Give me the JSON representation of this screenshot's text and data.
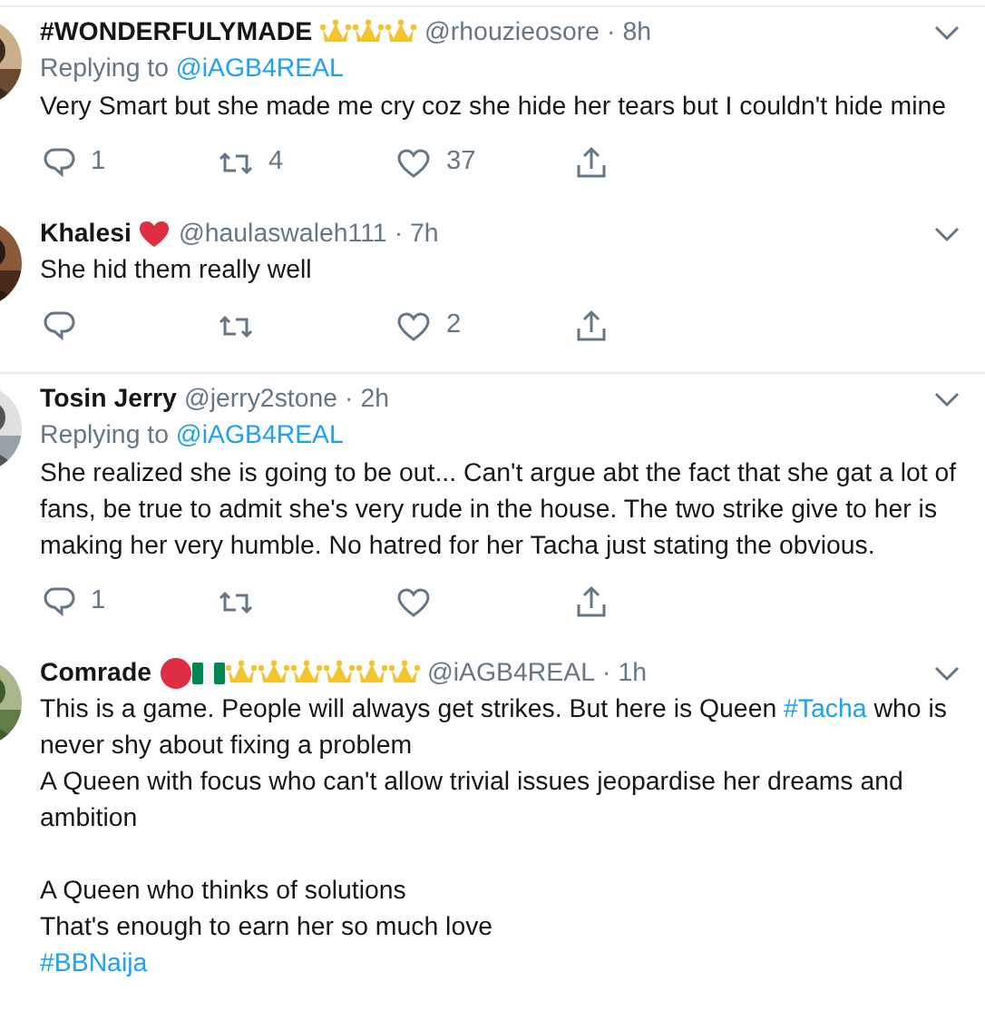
{
  "tweets": [
    {
      "name": "#WONDERFULYMADE",
      "badges": [
        {
          "kind": "crown"
        },
        {
          "kind": "crown"
        },
        {
          "kind": "crown"
        }
      ],
      "handle": "@rhouzieosore",
      "separator": "·",
      "time": "8h",
      "replying_label": "Replying to",
      "replying_to": "@iAGB4REAL",
      "paragraphs": [
        [
          [
            {
              "kind": "plain",
              "text": "Very Smart but she made me cry coz she hide her tears but I couldn't hide mine"
            }
          ]
        ]
      ],
      "replies": "1",
      "retweets": "4",
      "likes": "37",
      "divider": false
    },
    {
      "name": "Khalesi",
      "badges": [
        {
          "kind": "heart"
        }
      ],
      "handle": "@haulaswaleh111",
      "separator": "·",
      "time": "7h",
      "paragraphs": [
        [
          [
            {
              "kind": "plain",
              "text": "She hid them really well"
            }
          ]
        ]
      ],
      "likes": "2",
      "divider": false
    },
    {
      "name": "Tosin Jerry",
      "handle": "@jerry2stone",
      "separator": "·",
      "time": "2h",
      "replying_label": "Replying to",
      "replying_to": "@iAGB4REAL",
      "paragraphs": [
        [
          [
            {
              "kind": "plain",
              "text": "She realized she is going to be out... Can't argue abt the fact that she gat a lot of fans, be true to admit she's very rude in the house. The two strike give to her is making her very humble. No hatred for her Tacha just stating the obvious."
            }
          ]
        ]
      ],
      "replies": "1",
      "divider": true
    },
    {
      "name": "Comrade",
      "badges": [
        {
          "kind": "red-circle"
        },
        {
          "kind": "flag"
        },
        {
          "kind": "crown"
        },
        {
          "kind": "crown"
        },
        {
          "kind": "crown"
        },
        {
          "kind": "crown"
        },
        {
          "kind": "crown"
        },
        {
          "kind": "crown"
        }
      ],
      "handle": "@iAGB4REAL",
      "separator": "·",
      "time": "1h",
      "paragraphs": [
        [
          [
            {
              "kind": "plain",
              "text": "This is a game. People will always get strikes. But here is Queen "
            },
            {
              "kind": "hashtag",
              "text": "#Tacha"
            },
            {
              "kind": "plain",
              "text": " who is never shy about fixing a problem"
            }
          ],
          [
            {
              "kind": "plain",
              "text": "A Queen with focus who can't allow trivial issues jeopardise her dreams and ambition"
            }
          ]
        ],
        [
          [
            {
              "kind": "plain",
              "text": "A Queen who thinks of solutions"
            }
          ],
          [
            {
              "kind": "plain",
              "text": "That's enough to earn her so much love"
            }
          ],
          [
            {
              "kind": "hashtag",
              "text": "#BBNaija"
            }
          ]
        ]
      ],
      "divider": false
    }
  ]
}
